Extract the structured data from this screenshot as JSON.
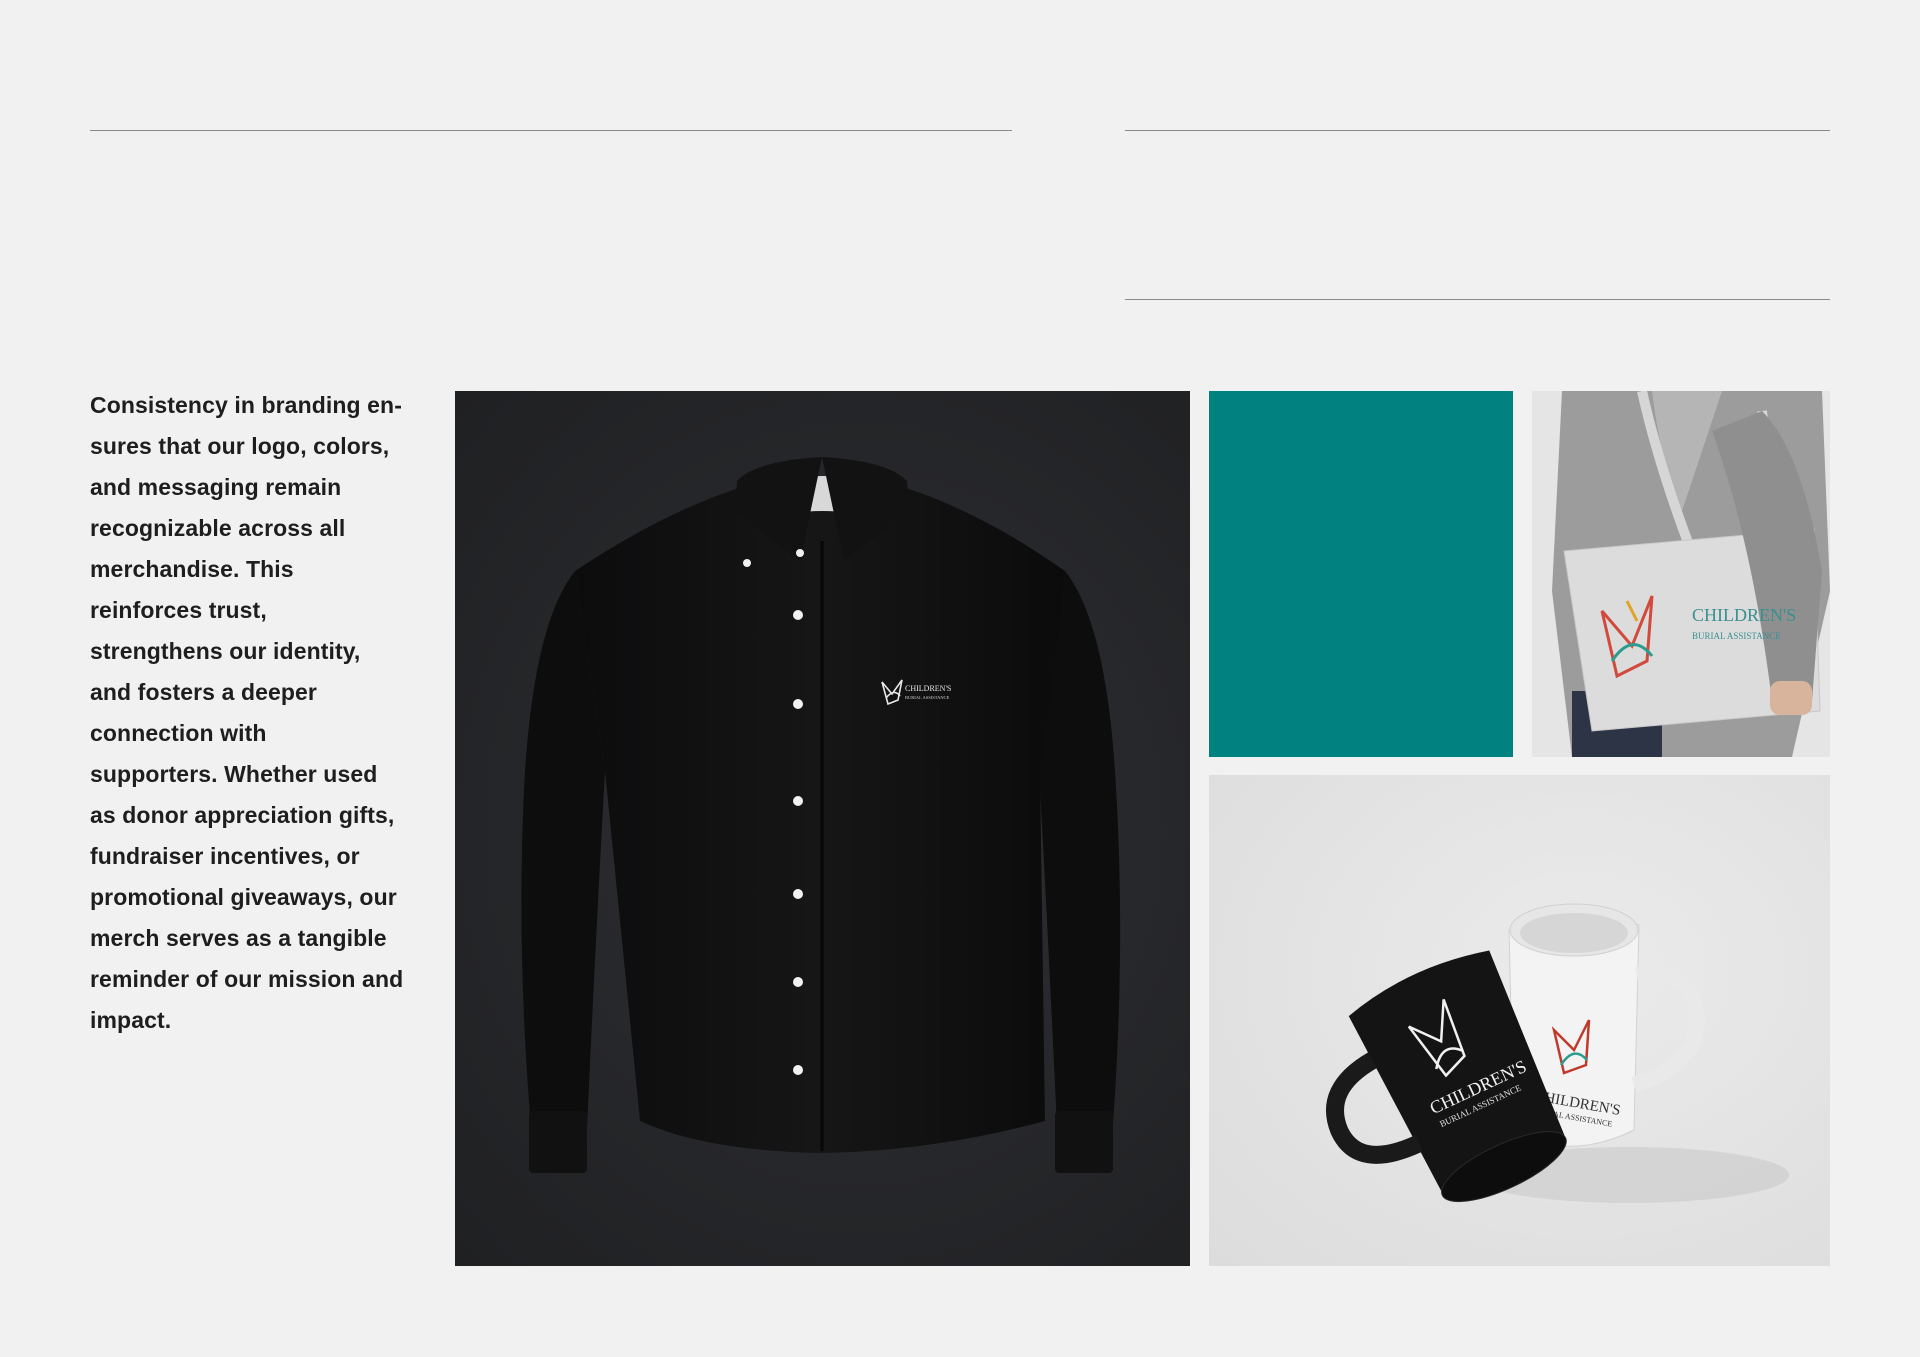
{
  "paragraph": {
    "lines": [
      "Consistency in branding en-",
      "sures that our logo, colors,",
      "and messaging remain",
      "recognizable across all",
      "merchandise. This",
      "reinforces trust,",
      "strengthens our identity,",
      "and fosters a deeper",
      "connection with",
      "supporters. Whether used",
      "as donor appreciation gifts,",
      "fundraiser incentives, or",
      "promotional giveaways, our",
      "merch serves as a tangible",
      "reminder of our mission and",
      "impact."
    ]
  },
  "brand": {
    "logo_line1": "CHILDREN'S",
    "logo_line2": "BURIAL ASSISTANCE"
  },
  "colors": {
    "brand_teal": "#028181",
    "shirt_background": "#26272a",
    "page_background": "#f1f1f1"
  },
  "icons": {
    "logo_mark": "butterfly-logo-icon"
  }
}
